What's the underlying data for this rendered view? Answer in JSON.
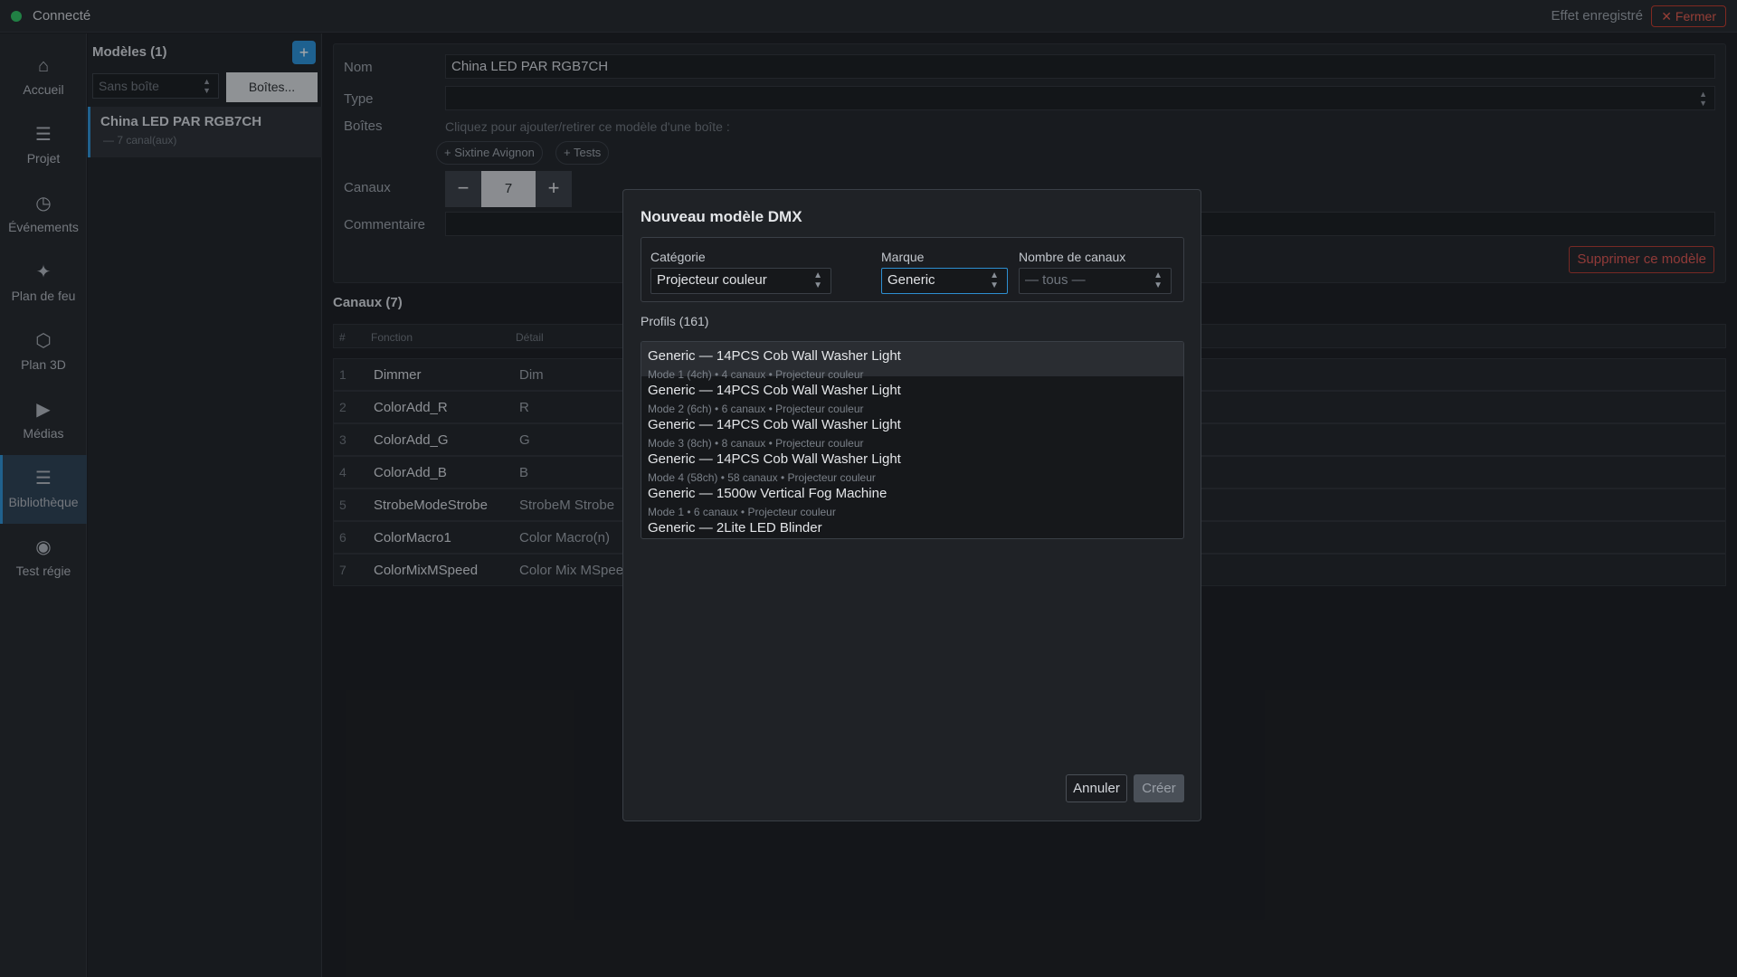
{
  "topbar": {
    "status": "Connecté",
    "saved": "Effet enregistré",
    "close": "✕ Fermer",
    "status_color": "#2fbf61"
  },
  "nav": [
    {
      "label": "Accueil",
      "icon": "home-icon",
      "glyph": "⌂"
    },
    {
      "label": "Projet",
      "icon": "menu-icon",
      "glyph": "☰"
    },
    {
      "label": "Événements",
      "icon": "clock-icon",
      "glyph": "◷"
    },
    {
      "label": "Plan de feu",
      "icon": "sparkle-icon",
      "glyph": "✦"
    },
    {
      "label": "Plan 3D",
      "icon": "cube-icon",
      "glyph": "⬡"
    },
    {
      "label": "Médias",
      "icon": "play-icon",
      "glyph": "▶"
    },
    {
      "label": "Bibliothèque",
      "icon": "library-icon",
      "glyph": "☰"
    },
    {
      "label": "Test régie",
      "icon": "target-icon",
      "glyph": "◉"
    }
  ],
  "models": {
    "title": "Modèles (1)",
    "add": "+",
    "box_filter": "Sans boîte",
    "boxes_button": "Boîtes...",
    "items": [
      {
        "name": "China LED PAR RGB7CH",
        "sub": "— 7 canal(aux)"
      }
    ]
  },
  "detail": {
    "name_label": "Nom",
    "name_value": "China LED PAR RGB7CH",
    "type_label": "Type",
    "type_value": "",
    "boxes_label": "Boîtes",
    "boxes_hint": "Cliquez pour ajouter/retirer ce modèle d'une boîte :",
    "chips": [
      "+ Sixtine Avignon",
      "+ Tests"
    ],
    "channels_label": "Canaux",
    "channels_value": "7",
    "minus": "−",
    "plus": "+",
    "comment_label": "Commentaire",
    "comment_value": "",
    "delete": "Supprimer ce modèle"
  },
  "channels": {
    "title": "Canaux (7)",
    "headers": [
      "#",
      "Fonction",
      "Détail"
    ],
    "rows": [
      {
        "n": "1",
        "f": "Dimmer",
        "d": "Dim"
      },
      {
        "n": "2",
        "f": "ColorAdd_R",
        "d": "R"
      },
      {
        "n": "3",
        "f": "ColorAdd_G",
        "d": "G"
      },
      {
        "n": "4",
        "f": "ColorAdd_B",
        "d": "B"
      },
      {
        "n": "5",
        "f": "StrobeModeStrobe",
        "d": "StrobeM Strobe"
      },
      {
        "n": "6",
        "f": "ColorMacro1",
        "d": "Color Macro(n)"
      },
      {
        "n": "7",
        "f": "ColorMixMSpeed",
        "d": "Color Mix MSpeed"
      }
    ]
  },
  "modal": {
    "title": "Nouveau modèle DMX",
    "category_label": "Catégorie",
    "category_value": "Projecteur couleur",
    "brand_label": "Marque",
    "brand_value": "Generic",
    "count_label": "Nombre de canaux",
    "count_value": "— tous —",
    "profiles_label": "Profils (161)",
    "profiles": [
      {
        "title": "Generic — 14PCS Cob Wall Washer Light",
        "sub": "Mode 1 (4ch)  •  4 canaux  •  Projecteur couleur"
      },
      {
        "title": "Generic — 14PCS Cob Wall Washer Light",
        "sub": "Mode 2 (6ch)  •  6 canaux  •  Projecteur couleur"
      },
      {
        "title": "Generic — 14PCS Cob Wall Washer Light",
        "sub": "Mode 3 (8ch)  •  8 canaux  •  Projecteur couleur"
      },
      {
        "title": "Generic — 14PCS Cob Wall Washer Light",
        "sub": "Mode 4 (58ch)  •  58 canaux  •  Projecteur couleur"
      },
      {
        "title": "Generic — 1500w Vertical Fog Machine",
        "sub": "Mode 1  •  6 canaux  •  Projecteur couleur"
      },
      {
        "title": "Generic — 2Lite LED Blinder",
        "sub": ""
      }
    ],
    "cancel": "Annuler",
    "create": "Créer"
  }
}
